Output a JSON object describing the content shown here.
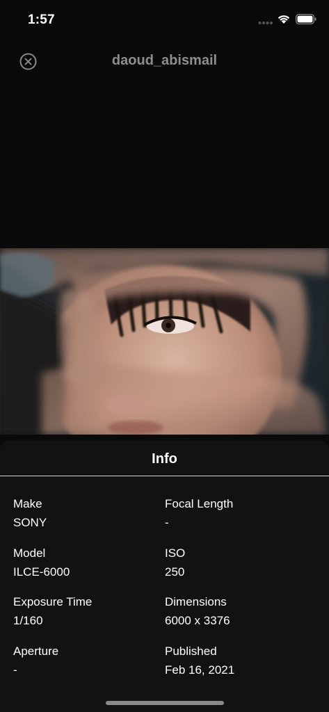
{
  "status_bar": {
    "time": "1:57",
    "icons": [
      "signal-icon",
      "wifi-icon",
      "battery-icon"
    ]
  },
  "nav": {
    "title": "daoud_abismail",
    "close_icon": "close-circle-icon"
  },
  "info": {
    "title": "Info",
    "fields": {
      "make": {
        "label": "Make",
        "value": "SONY"
      },
      "focal_length": {
        "label": "Focal Length",
        "value": "-"
      },
      "model": {
        "label": "Model",
        "value": "ILCE-6000"
      },
      "iso": {
        "label": "ISO",
        "value": "250"
      },
      "exposure_time": {
        "label": "Exposure Time",
        "value": "1/160"
      },
      "dimensions": {
        "label": "Dimensions",
        "value": "6000 x 3376"
      },
      "aperture": {
        "label": "Aperture",
        "value": "-"
      },
      "published": {
        "label": "Published",
        "value": "Feb 16, 2021"
      }
    }
  },
  "colors": {
    "background": "#0a0a0a",
    "sheet": "#121212",
    "title_gray": "#8e8e8e",
    "text": "#ffffff"
  }
}
